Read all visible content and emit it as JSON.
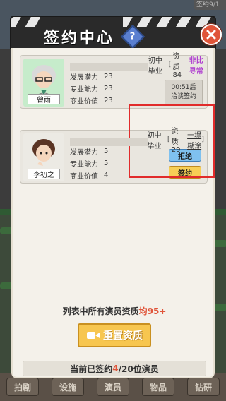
{
  "background": {
    "top_chip": "签约9/1",
    "nav": [
      "拍剧",
      "设施",
      "演员",
      "物品",
      "钻研"
    ]
  },
  "dialog": {
    "title": "签约中心",
    "help_label": "?",
    "actors": [
      {
        "name": "曾雨",
        "education": "初中毕业",
        "quality_prefix": "资质84",
        "quality_tag": "非比寻常",
        "stats": [
          {
            "label": "发展潜力",
            "value": "23"
          },
          {
            "label": "专业能力",
            "value": "23"
          },
          {
            "label": "商业价值",
            "value": "23"
          }
        ],
        "timer": "00:51后",
        "timer_status": "洽谈签约"
      },
      {
        "name": "李初之",
        "education": "初中毕业",
        "quality_prefix": "资质29",
        "quality_tag": "一塌糊涂",
        "stats": [
          {
            "label": "发展潜力",
            "value": "5"
          },
          {
            "label": "专业能力",
            "value": "5"
          },
          {
            "label": "商业价值",
            "value": "4"
          }
        ],
        "reject_label": "拒绝",
        "sign_label": "签约"
      }
    ],
    "summary_prefix": "列表中所有演员资质",
    "summary_value": "均95+",
    "reset_label": "重置资质",
    "status_prefix": "当前已签约",
    "status_current": "4",
    "status_suffix": "/20位演员"
  },
  "colors": {
    "accent": "#e0553a",
    "quality_rare": "#b040d0",
    "reject_button": "#7fc1ef",
    "sign_button": "#f7cf55",
    "highlight": "#e12b2b"
  }
}
